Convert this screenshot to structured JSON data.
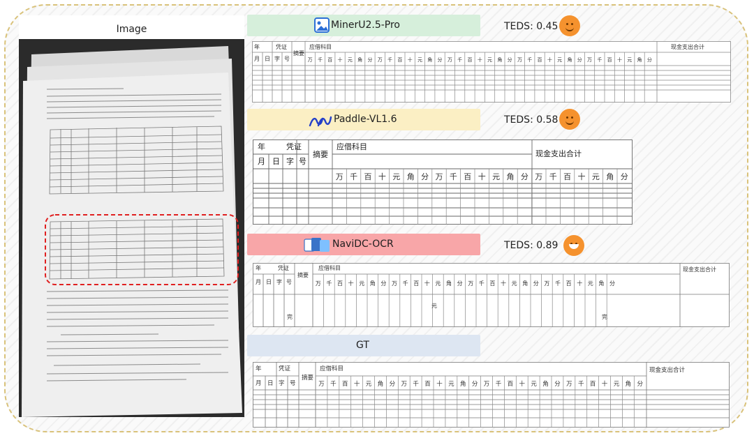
{
  "left_title": "Image",
  "rows": [
    {
      "name": "MinerU2.5-Pro",
      "teds": "TEDS: 0.45"
    },
    {
      "name": "Paddle-VL1.6",
      "teds": "TEDS: 0.58"
    },
    {
      "name": "NaviDC-OCR",
      "teds": "TEDS: 0.89"
    },
    {
      "name": "GT",
      "teds": ""
    }
  ],
  "ledger": {
    "year": "年",
    "voucher": "凭证",
    "summary": "摘要",
    "receivable": "应借科目",
    "cash_total": "现金支出合计",
    "month": "月",
    "day": "日",
    "zi": "字",
    "hao": "号",
    "unit_digits": [
      "万",
      "千",
      "百",
      "十",
      "元",
      "角",
      "分"
    ],
    "yuan_mark": "元",
    "end_mark": "完"
  },
  "colors": {
    "mineru": "#d6efdb",
    "paddle": "#fbefc4",
    "navidc": "#f8a6a8",
    "gt": "#dde6f2",
    "frame": "#d9c27a",
    "face": "#f5922e",
    "dash_red": "#e02020"
  }
}
